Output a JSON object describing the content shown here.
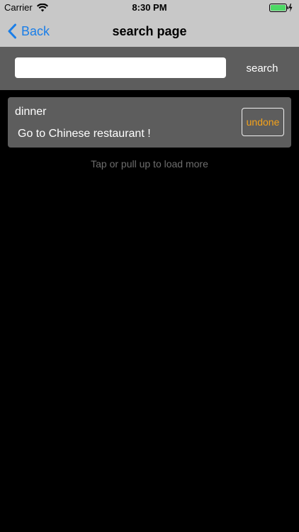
{
  "status_bar": {
    "carrier": "Carrier",
    "time": "8:30 PM",
    "battery_level": 1.0,
    "battery_color": "#4cd964"
  },
  "nav": {
    "back_label": "Back",
    "title": "search page",
    "accent_color": "#1a7ee8"
  },
  "search": {
    "input_value": "",
    "placeholder": "",
    "button_label": "search"
  },
  "list": {
    "items": [
      {
        "title": "dinner",
        "description": "Go to Chinese restaurant !",
        "status_label": "undone",
        "status_color": "#f4a21a"
      }
    ],
    "load_more_label": "Tap or pull up to load more"
  },
  "icons": {
    "wifi": "wifi-icon",
    "battery": "battery-icon",
    "back": "chevron-left-icon"
  }
}
